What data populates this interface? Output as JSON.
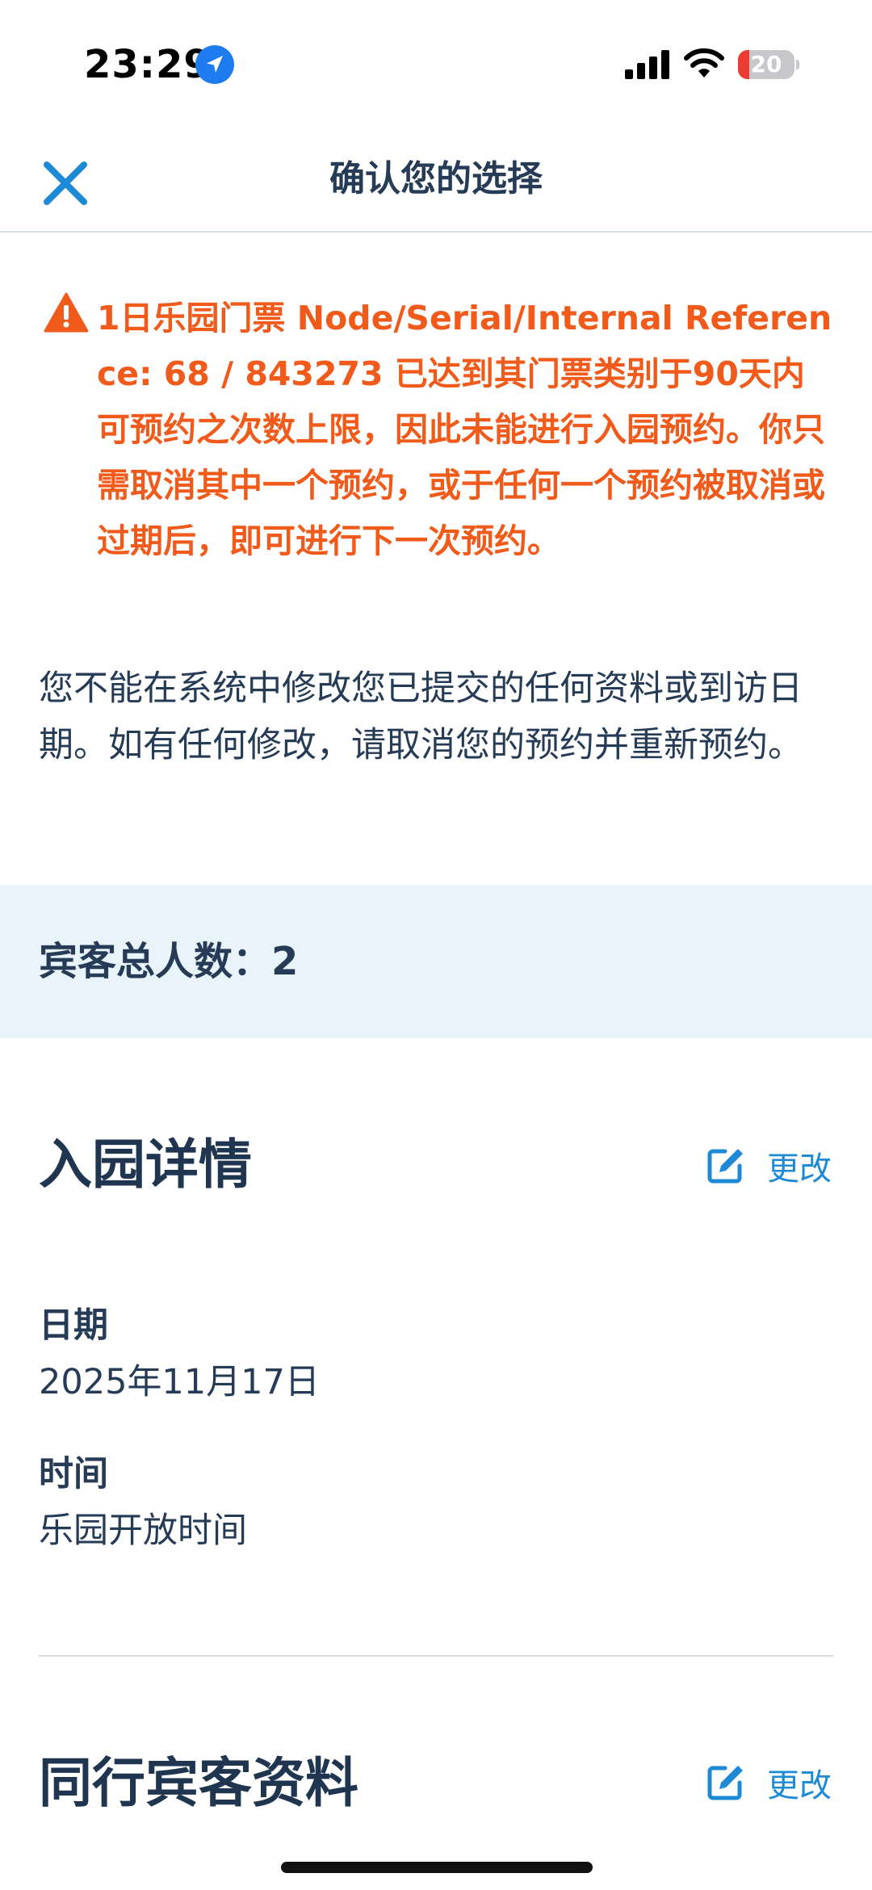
{
  "status_bar": {
    "time": "23:29",
    "location_icon": "location-arrow-icon",
    "signal_icon": "cellular-signal-icon",
    "wifi_icon": "wifi-icon",
    "battery_level": "20"
  },
  "header": {
    "close_icon": "close-icon",
    "title": "确认您的选择"
  },
  "warning": {
    "icon": "warning-triangle-icon",
    "message": "1日乐园门票 Node/Serial/Internal Reference: 68 / 843273 已达到其门票类别于90天内可预约之次数上限，因此未能进行入园预约。你只需取消其中一个预约，或于任何一个预约被取消或过期后，即可进行下一次预约。"
  },
  "notice": "您不能在系统中修改您已提交的任何资料或到访日期。如有任何修改，请取消您的预约并重新预约。",
  "guests": {
    "total_label": "宾客总人数：2"
  },
  "entry_details": {
    "title": "入园详情",
    "edit_label": "更改",
    "date_label": "日期",
    "date_value": "2025年11月17日",
    "time_label": "时间",
    "time_value": "乐园开放时间"
  },
  "companions": {
    "title": "同行宾客资料",
    "edit_label": "更改"
  },
  "colors": {
    "primary_text": "#253b56",
    "warning": "#f05a1a",
    "accent": "#1e8ad6",
    "band": "#e8f3fa"
  }
}
